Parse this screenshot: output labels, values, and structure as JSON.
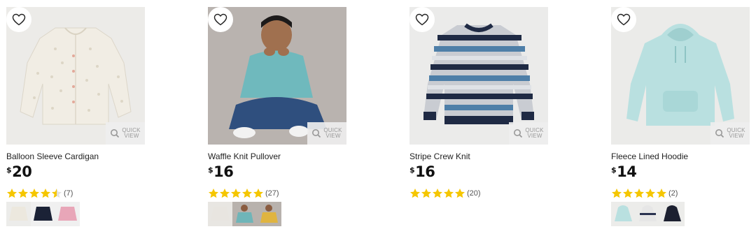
{
  "quick_view": {
    "line1": "QUICK",
    "line2": "VIEW"
  },
  "products": [
    {
      "name": "Balloon Sleeve Cardigan",
      "currency": "$",
      "price": "20",
      "rating": 4.5,
      "review_count": "(7)",
      "swatch_colors": [
        "#ece8de",
        "#1b2236",
        "#e8a6b8"
      ]
    },
    {
      "name": "Waffle Knit Pullover",
      "currency": "$",
      "price": "16",
      "rating": 5,
      "review_count": "(27)",
      "swatch_colors": [
        "#e8e5e0",
        "#6fb5b8",
        "#e0b440"
      ]
    },
    {
      "name": "Stripe Crew Knit",
      "currency": "$",
      "price": "16",
      "rating": 5,
      "review_count": "(20)",
      "swatch_colors": []
    },
    {
      "name": "Fleece Lined Hoodie",
      "currency": "$",
      "price": "14",
      "rating": 5,
      "review_count": "(2)",
      "swatch_colors": [
        "#b9e0e0",
        "#e6e6e6",
        "#1c2030"
      ]
    }
  ],
  "colors": {
    "star": "#f5c600",
    "price": "#111111"
  }
}
